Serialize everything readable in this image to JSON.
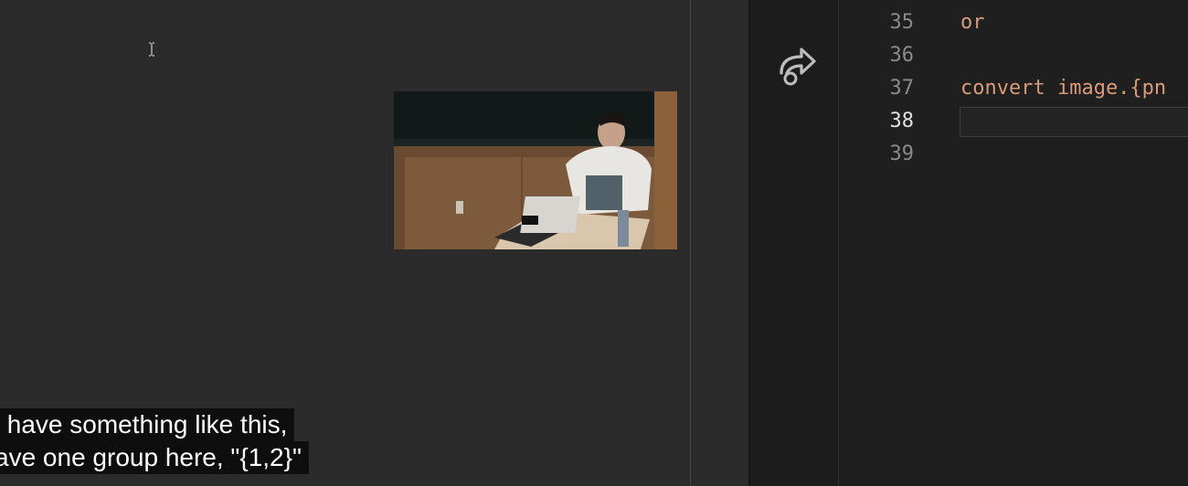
{
  "editor": {
    "line_numbers": [
      "35",
      "36",
      "37",
      "38",
      "39"
    ],
    "active_line": "38",
    "code_lines": [
      "or",
      "",
      "convert image.{pn",
      "",
      ""
    ]
  },
  "captions": {
    "line1": " have something like this,",
    "line2": "ave one group here, \"{1,2}\""
  },
  "icons": {
    "share": "share-arrow-icon",
    "text_cursor": "i-beam-cursor-icon"
  },
  "colors": {
    "code_text": "#d99a7a",
    "line_number": "#8a8a8a",
    "line_number_active": "#e2e2e2",
    "editor_bg": "#1f1f1f",
    "slide_bg": "#2b2b2b"
  }
}
